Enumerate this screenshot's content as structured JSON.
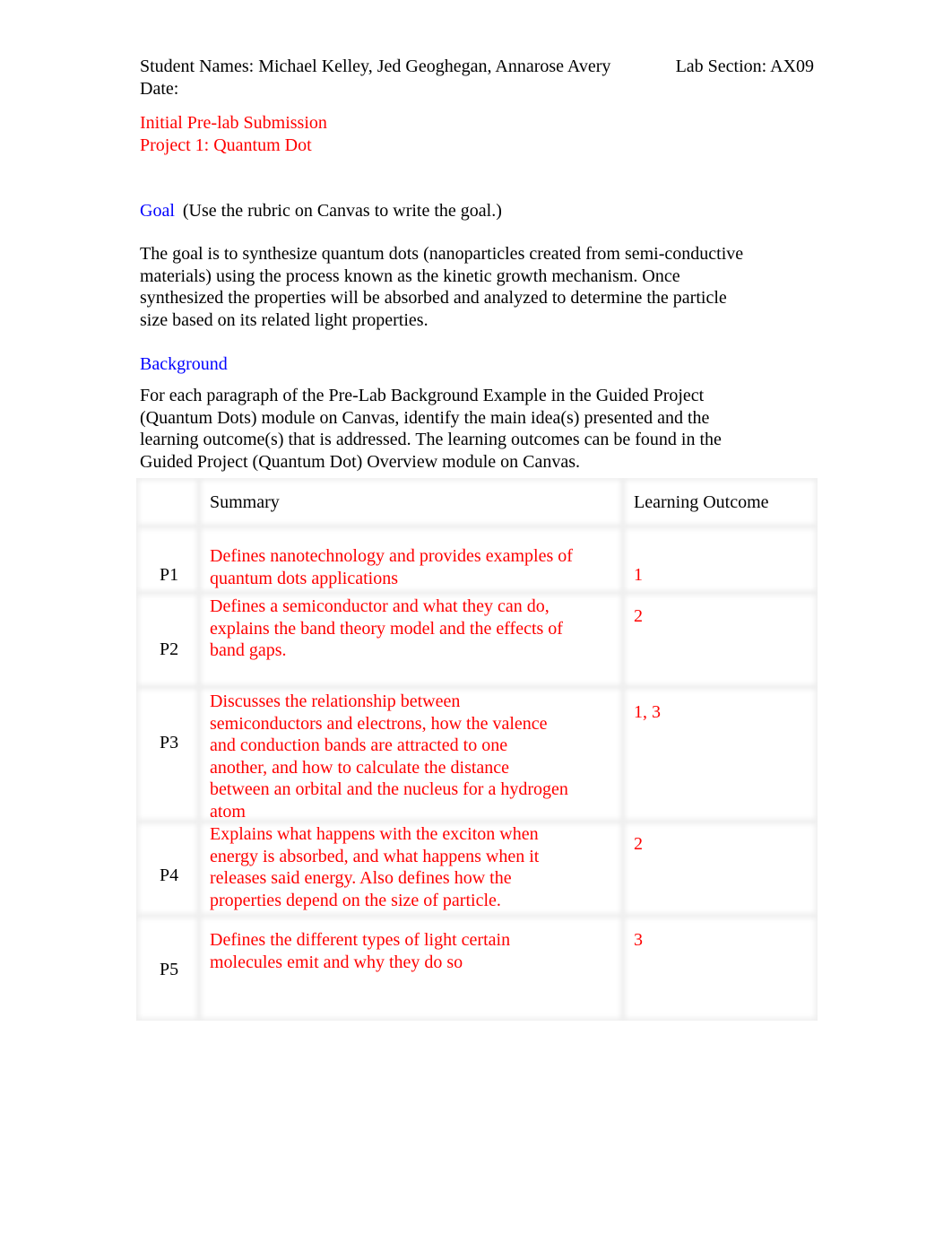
{
  "header": {
    "student_names": "Student Names: Michael Kelley, Jed Geoghegan, Annarose Avery",
    "lab_section": "Lab Section: AX09",
    "date_label": "Date:"
  },
  "submission": {
    "title": "Initial Pre-lab Submission",
    "project": "Project 1: Quantum Dot"
  },
  "goal": {
    "heading": "Goal",
    "instruction": "(Use the rubric on Canvas to write the goal.)",
    "lines": [
      "The goal is to synthesize quantum dots (nanoparticles created from semi-conductive",
      "materials) using the process known as the kinetic growth mechanism. Once",
      "synthesized the properties will be absorbed and analyzed to determine the particle",
      "size based on its related light properties."
    ]
  },
  "background": {
    "heading": "Background",
    "lines": [
      "For each paragraph of the Pre-Lab Background Example in the Guided Project",
      "(Quantum Dots) module on Canvas, identify the main idea(s) presented and the",
      "learning outcome(s) that is addressed. The learning outcomes can be found in the",
      "Guided Project (Quantum Dot) Overview module on Canvas."
    ]
  },
  "table": {
    "headers": [
      "",
      "Summary",
      "Learning Outcome"
    ],
    "rows": [
      {
        "label": "P1",
        "summary": [
          "Defines nanotechnology and provides examples of",
          "quantum dots applications"
        ],
        "outcome": "1"
      },
      {
        "label": "P2",
        "summary": [
          "Defines a semiconductor and what they can do,",
          "explains the band theory model and the effects of",
          "band gaps."
        ],
        "outcome": "2"
      },
      {
        "label": "P3",
        "summary": [
          "Discusses the relationship between",
          "semiconductors and electrons, how the valence",
          "and conduction bands are attracted to one",
          "another, and how to calculate the distance",
          "between an orbital and the nucleus for a hydrogen",
          "atom"
        ],
        "outcome": "1, 3"
      },
      {
        "label": "P4",
        "summary": [
          "Explains what happens with the exciton when",
          "energy is absorbed, and what happens when it",
          "releases said energy. Also defines how the",
          "properties depend on the size of particle."
        ],
        "outcome": "2"
      },
      {
        "label": "P5",
        "summary": [
          "Defines the different types of light certain",
          "molecules emit and why they do so"
        ],
        "outcome": "3"
      }
    ]
  },
  "colors": {
    "answer_text": "#ff0000",
    "heading_text": "#0000ff",
    "body_text": "#000000",
    "table_border": "#efefef"
  }
}
